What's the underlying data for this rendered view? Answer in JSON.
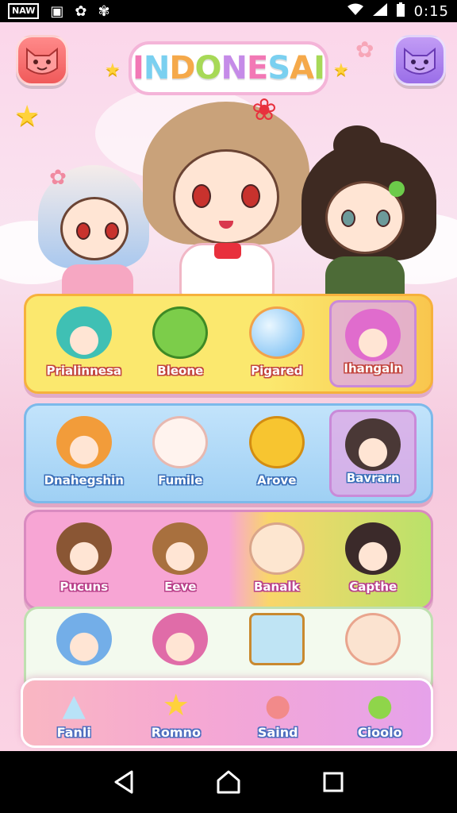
{
  "status_bar": {
    "icons": [
      "NAW",
      "▣",
      "✿",
      "✾"
    ],
    "time": "0:15",
    "wifi_icon": "▾",
    "signal_icon": "◢",
    "battery_icon": "▮"
  },
  "title": "INDONESAI",
  "title_colors": [
    "#f278b5",
    "#7ad0f0",
    "#f5a94a",
    "#a7d957",
    "#c58be8",
    "#f278b5",
    "#7ad0f0",
    "#f5a94a",
    "#a7d957"
  ],
  "top_left_button": {
    "icon": "cat-face-icon"
  },
  "top_right_button": {
    "icon": "cat-face-icon"
  },
  "rows": [
    {
      "items": [
        {
          "label": "Prialinnesa",
          "art": "teal-hair-avatar",
          "color": "#3fc0b4"
        },
        {
          "label": "Bleone",
          "art": "green-monster",
          "color": "#7ccd4a"
        },
        {
          "label": "Pigared",
          "art": "blue-orb",
          "color": "#6ab7f2"
        },
        {
          "label": "Ihangaln",
          "art": "pink-hair-avatar",
          "color": "#e06ccd",
          "selected": true
        }
      ]
    },
    {
      "items": [
        {
          "label": "Dnahegshin",
          "art": "orange-hair-avatar",
          "color": "#f29c3a"
        },
        {
          "label": "Fumile",
          "art": "white-bun",
          "color": "#fff3ee"
        },
        {
          "label": "Arove",
          "art": "yellow-chick",
          "color": "#f7c530"
        },
        {
          "label": "Bavrarn",
          "art": "dark-hair-avatar",
          "color": "#4a3836",
          "selected": true
        }
      ]
    },
    {
      "items": [
        {
          "label": "Pucuns",
          "art": "brown-hair-avatar",
          "color": "#8a5634"
        },
        {
          "label": "Eeve",
          "art": "brown-hair-avatar",
          "color": "#a8703e"
        },
        {
          "label": "Banalk",
          "art": "cream-cat",
          "color": "#fde6d0"
        },
        {
          "label": "Capthe",
          "art": "black-hair-avatar",
          "color": "#3b2a2a"
        }
      ]
    },
    {
      "items": [
        {
          "label": "",
          "art": "blue-hair-avatar",
          "color": "#73aee8"
        },
        {
          "label": "",
          "art": "pink-hair-avatar",
          "color": "#e06ca8"
        },
        {
          "label": "",
          "art": "cake",
          "color": "#bfe4f4"
        },
        {
          "label": "",
          "art": "peach-orb",
          "color": "#fbe3d0"
        }
      ]
    }
  ],
  "bottom_bar": [
    {
      "label": "Fanli",
      "icon": "crystal-icon",
      "glyph": "▲",
      "color": "#b8e2f7"
    },
    {
      "label": "Romno",
      "icon": "star-icon",
      "glyph": "★",
      "color": "#ffd23c"
    },
    {
      "label": "Saind",
      "icon": "peach-icon",
      "glyph": "●",
      "color": "#f28a8a"
    },
    {
      "label": "Cioolo",
      "icon": "green-orb-icon",
      "glyph": "●",
      "color": "#8fd54a"
    }
  ]
}
